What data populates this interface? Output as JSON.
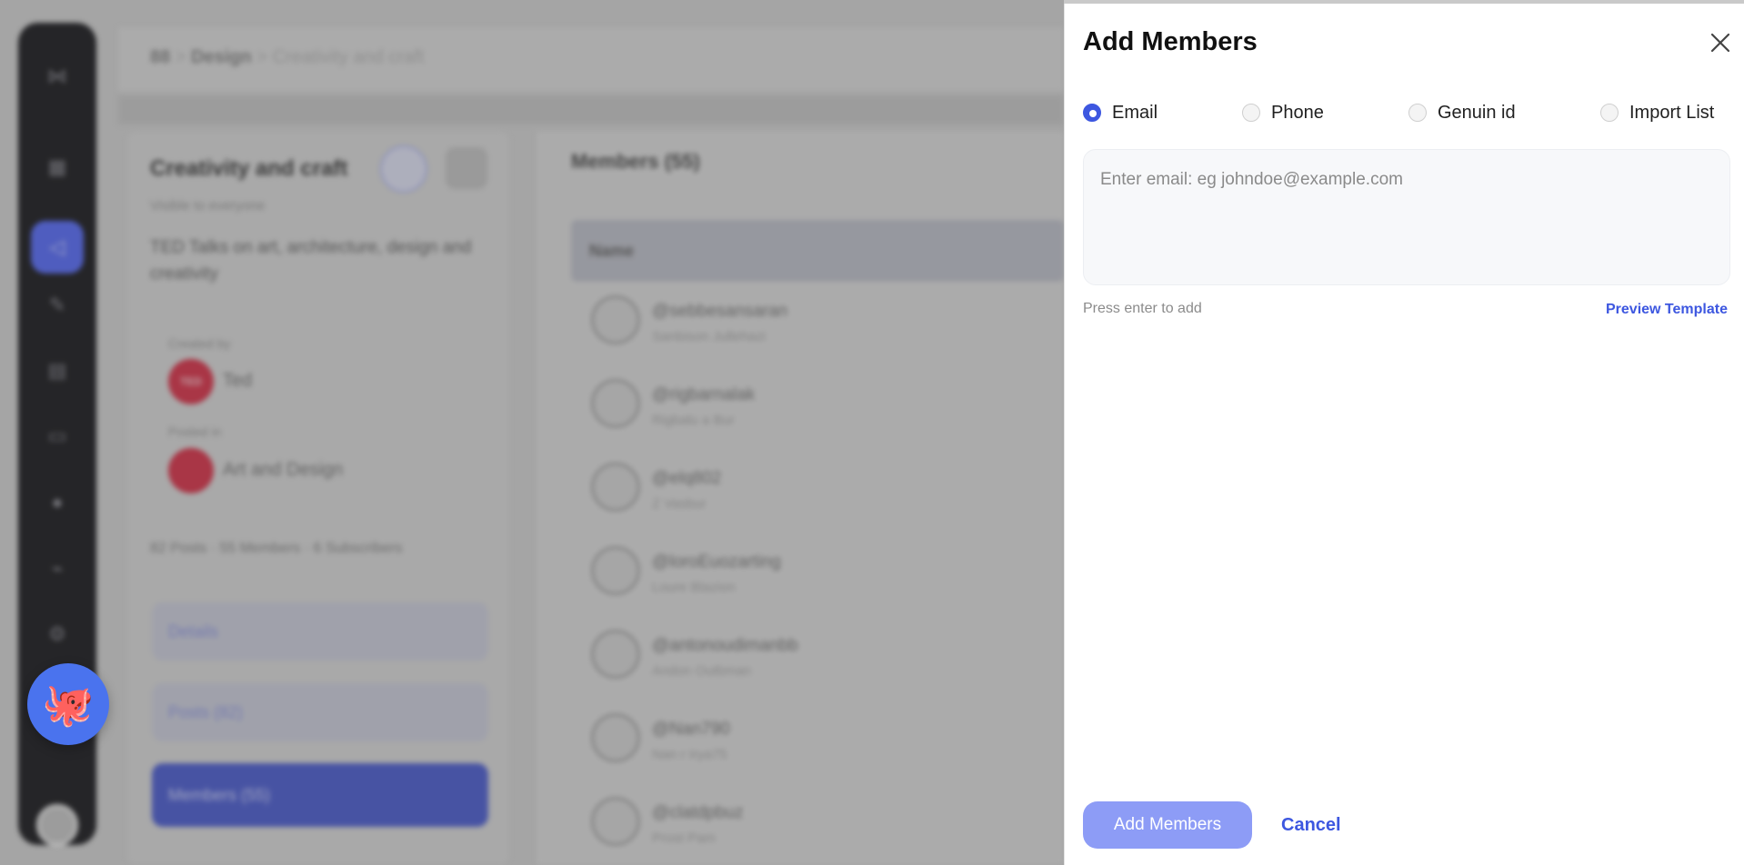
{
  "background": {
    "breadcrumb": {
      "home": "88",
      "parent": "Design",
      "current": "Creativity and craft"
    },
    "community": {
      "title": "Creativity and craft",
      "visibility": "Visible to everyone",
      "description": "TED Talks on art, architecture, design and creativity",
      "created_by_label": "Created by",
      "created_by_initials": "TED",
      "created_by_name": "Ted",
      "posted_in_label": "Posted in",
      "posted_in_name": "Art and Design",
      "stats": "82 Posts · 55 Members · 6 Subscribers",
      "menu": [
        {
          "label": "Details"
        },
        {
          "label": "Posts (82)"
        },
        {
          "label": "Members (55)"
        }
      ]
    },
    "members": {
      "title": "Members (55)",
      "header": "Name",
      "rows": [
        {
          "name": "@sebbesansaran",
          "sub": "Sanbison Jullehazi"
        },
        {
          "name": "@rigbarnalak",
          "sub": "Rigbalu a Bur"
        },
        {
          "name": "@elq802",
          "sub": "Z Vasbur"
        },
        {
          "name": "@loroEuozarting",
          "sub": "Loure Blazion"
        },
        {
          "name": "@antonoudimanbb",
          "sub": "Andon Outbman"
        },
        {
          "name": "@Nan790",
          "sub": "Nan r Irya75"
        },
        {
          "name": "@clatdpbuz",
          "sub": "Prost Pam"
        }
      ]
    }
  },
  "drawer": {
    "title": "Add Members",
    "options": [
      {
        "label": "Email",
        "selected": true
      },
      {
        "label": "Phone",
        "selected": false
      },
      {
        "label": "Genuin id",
        "selected": false
      },
      {
        "label": "Import List",
        "selected": false
      }
    ],
    "email_placeholder": "Enter email: eg johndoe@example.com",
    "hint": "Press enter to add",
    "preview_link": "Preview Template",
    "primary_button": "Add Members",
    "cancel_button": "Cancel"
  },
  "colors": {
    "accent": "#3d57e0",
    "primary_button_bg": "#8d9cf6",
    "floating_button_bg": "#4a73ee"
  },
  "icons": {
    "close": "close-icon",
    "floating_assistant": "octopus-icon"
  }
}
